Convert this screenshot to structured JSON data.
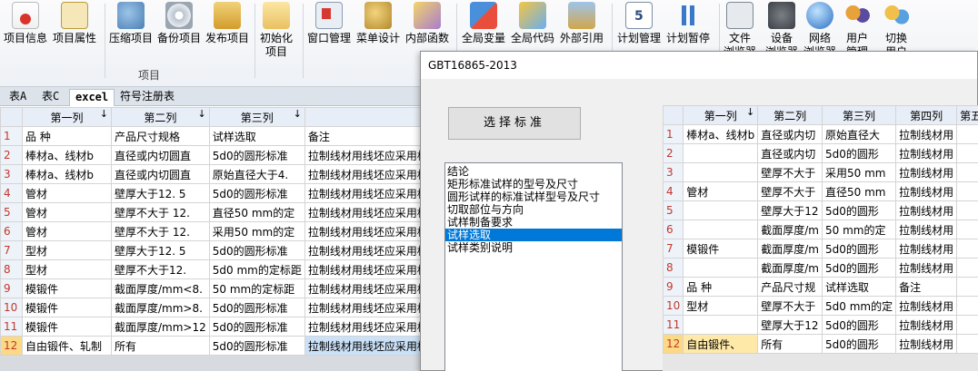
{
  "ribbon": {
    "buttons": [
      {
        "name": "project-info",
        "label": "项目信息",
        "icon": "doc-red"
      },
      {
        "name": "project-props",
        "label": "项目属性",
        "icon": "list"
      },
      {
        "name": "compress-project",
        "label": "压缩项目",
        "icon": "tools"
      },
      {
        "name": "backup-project",
        "label": "备份项目",
        "icon": "disk"
      },
      {
        "name": "publish-project",
        "label": "发布项目",
        "icon": "pub"
      },
      {
        "name": "init-project",
        "label": "初始化\n项目",
        "icon": "init"
      },
      {
        "name": "window-mgmt",
        "label": "窗口管理",
        "icon": "win"
      },
      {
        "name": "menu-design",
        "label": "菜单设计",
        "icon": "menu"
      },
      {
        "name": "internal-func",
        "label": "内部函数",
        "icon": "func"
      },
      {
        "name": "global-var",
        "label": "全局变量",
        "icon": "gvar"
      },
      {
        "name": "global-code",
        "label": "全局代码",
        "icon": "gcode"
      },
      {
        "name": "external-ref",
        "label": "外部引用",
        "icon": "ext"
      },
      {
        "name": "plan-mgmt",
        "label": "计划管理",
        "icon": "cal"
      },
      {
        "name": "plan-pause",
        "label": "计划暂停",
        "icon": "pause"
      },
      {
        "name": "file-mgr",
        "label": "文件\n浏览器",
        "icon": "file"
      },
      {
        "name": "device-mgr",
        "label": "设备\n浏览器",
        "icon": "dev"
      },
      {
        "name": "network",
        "label": "网络\n浏览器",
        "icon": "net"
      },
      {
        "name": "user-mgmt",
        "label": "用户\n管理",
        "icon": "user"
      },
      {
        "name": "switch-user",
        "label": "切换\n用户",
        "icon": "switch"
      }
    ],
    "group_label": "项目"
  },
  "tabs": [
    "表A",
    "表C",
    "excel",
    "符号注册表"
  ],
  "left_grid": {
    "headers": [
      "第一列",
      "第二列",
      "第三列"
    ],
    "rows": [
      [
        "品 种",
        "产品尺寸规格",
        "试样选取",
        "备注"
      ],
      [
        "棒材a、线材b",
        "直径或内切圆直",
        "5d0的圆形标准",
        "拉制线材用线坯应采用标"
      ],
      [
        "棒材a、线材b",
        "直径或内切圆直",
        "原始直径大于4.",
        "拉制线材用线坯应采用标"
      ],
      [
        "管材",
        "壁厚大于12. 5",
        "5d0的圆形标准",
        "拉制线材用线坯应采用标"
      ],
      [
        "管材",
        "壁厚不大于 12.",
        "直径50 mm的定",
        "拉制线材用线坯应采用标"
      ],
      [
        "管材",
        "壁厚不大于 12.",
        "采用50 mm的定",
        "拉制线材用线坯应采用标"
      ],
      [
        "型材",
        "壁厚大于12. 5",
        "5d0的圆形标准",
        "拉制线材用线坯应采用标"
      ],
      [
        "型材",
        "壁厚不大于12.",
        "5d0 mm的定标距",
        "拉制线材用线坯应采用标"
      ],
      [
        "模锻件",
        "截面厚度/mm<8.",
        "50 mm的定标距",
        "拉制线材用线坯应采用标"
      ],
      [
        "模锻件",
        "截面厚度/mm>8.",
        "5d0的圆形标准",
        "拉制线材用线坯应采用标"
      ],
      [
        "模锻件",
        "截面厚度/mm>12",
        "5d0的圆形标准",
        "拉制线材用线坯应采用标"
      ],
      [
        "自由锻件、轧制",
        "所有",
        "5d0的圆形标准",
        "拉制线材用线坯应采用标"
      ]
    ]
  },
  "dialog": {
    "title": "GBT16865-2013",
    "select_button": "选择标准",
    "list_items": [
      "结论",
      "矩形标准试样的型号及尺寸",
      "圆形试样的标准试样型号及尺寸",
      "切取部位与方向",
      "试样制备要求",
      "试样选取",
      "试样类别说明"
    ],
    "selected_index": 5
  },
  "right_grid": {
    "headers": [
      "第一列",
      "第二列",
      "第三列",
      "第四列",
      "第五"
    ],
    "rows": [
      [
        "棒材a、线材b",
        "直径或内切",
        "原始直径大",
        "拉制线材用"
      ],
      [
        "",
        "直径或内切",
        "5d0的圆形",
        "拉制线材用"
      ],
      [
        "",
        "壁厚不大于",
        "采用50 mm",
        "拉制线材用"
      ],
      [
        "管材",
        "壁厚不大于",
        "直径50 mm",
        "拉制线材用"
      ],
      [
        "",
        "壁厚大于12",
        "5d0的圆形",
        "拉制线材用"
      ],
      [
        "",
        "截面厚度/m",
        "50 mm的定",
        "拉制线材用"
      ],
      [
        "模锻件",
        "截面厚度/m",
        "5d0的圆形",
        "拉制线材用"
      ],
      [
        "",
        "截面厚度/m",
        "5d0的圆形",
        "拉制线材用"
      ],
      [
        "品 种",
        "产品尺寸规",
        "试样选取",
        "备注"
      ],
      [
        "型材",
        "壁厚不大于",
        "5d0 mm的定",
        "拉制线材用"
      ],
      [
        "",
        "壁厚大于12",
        "5d0的圆形",
        "拉制线材用"
      ],
      [
        "自由锻件、",
        "所有",
        "5d0的圆形",
        "拉制线材用"
      ]
    ]
  },
  "colors": {
    "accent": "#0078d7",
    "row_number": "#c0392b",
    "selected_header": "#fcd984",
    "highlight": "#cbe1f7"
  }
}
